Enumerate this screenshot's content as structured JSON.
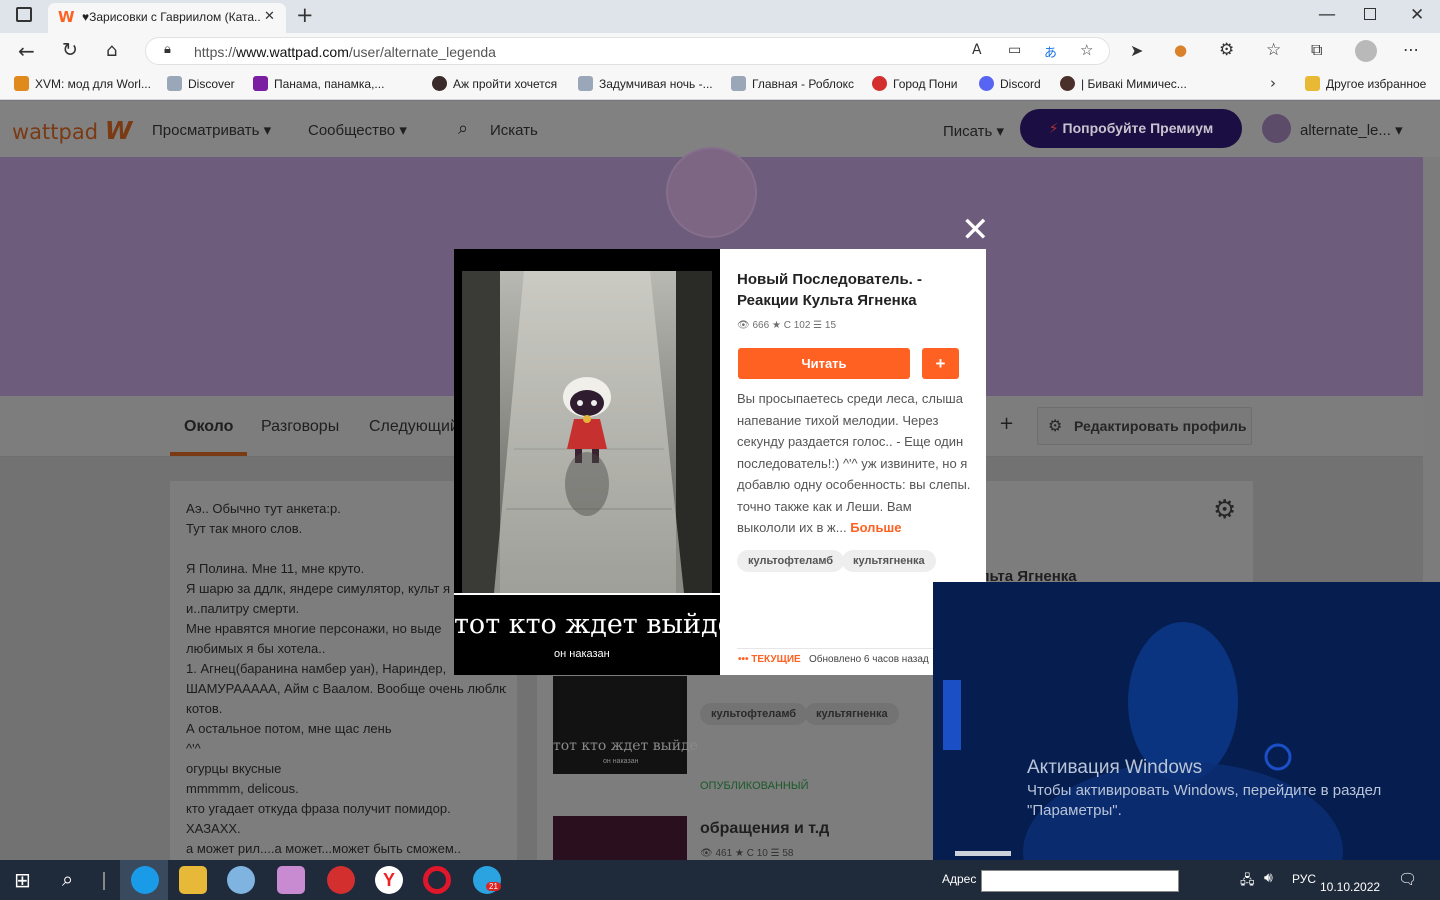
{
  "browser": {
    "tab_title": "♥Зарисовки с Гавриилом (Ката...",
    "url_prefix": "https://",
    "url_domain": "www.wattpad.com",
    "url_path": "/user/alternate_legenda",
    "favorites": [
      {
        "label": "XVM: мод для Worl...",
        "color": "#e08a1e"
      },
      {
        "label": "Discover",
        "color": "#9aa7b8"
      },
      {
        "label": "Панама, панамка,...",
        "color": "#7b1fa2"
      },
      {
        "label": "Аж пройти хочется",
        "color": "#3b2a2a"
      },
      {
        "label": "Задумчивая ночь -...",
        "color": "#9aa7b8"
      },
      {
        "label": "Главная - Роблокс",
        "color": "#9aa7b8"
      },
      {
        "label": "Город Пони",
        "color": "#d32f2f"
      },
      {
        "label": "Discord",
        "color": "#5865f2"
      },
      {
        "label": "| Бивакі Мимичес...",
        "color": "#4a2f2a"
      }
    ],
    "other_favorites": "Другое избранное"
  },
  "wattpad": {
    "logo": "wattpad",
    "browse": "Просматривать",
    "community": "Сообщество",
    "search": "Искать",
    "write": "Писать",
    "premium": "Попробуйте Премиум",
    "username": "alternate_le..."
  },
  "profile": {
    "tabs": [
      "Около",
      "Разговоры",
      "Следующий"
    ],
    "edit_profile": "Редактировать профиль",
    "about_lines": [
      "Аэ.. Обычно тут анкета:р.",
      "Тут так много слов.",
      "",
      "Я Полина. Мне 11, мне круто.",
      "Я шарю за ддлк, яндере симулятор, культ я",
      "и..палитру смерти.",
      "Мне нравятся многие персонажи, но выде",
      "любимых я бы хотела..",
      "1. Агнец(баранина намбер уан), Нариндер,",
      "ШАМУРААААА, Айм с Ваалом. Вообще очень люблю",
      "котов.",
      "А остальное потом, мне щас лень",
      "^'^",
      "огурцы вкусные",
      "mmmmm, delicous.",
      "кто угадает откуда фраза получит помидор.",
      "ХАЗАХХ.",
      "а может рил....а может...может быть сможем.."
    ],
    "stories": {
      "behind_title_fragment": "льта Ягненка",
      "tags": [
        "культофтеламб",
        "культягненка"
      ],
      "published_label": "ОПУБЛИКОВАННЫЙ",
      "second_title": "обращения и т.д",
      "second_stats": "461 ★ С 10 ☰ 58",
      "cover_caption": "тот кто ждет выйде",
      "cover_sub": "он наказан"
    }
  },
  "modal": {
    "title": "Новый Последователь. - Реакции Культа Ягненка",
    "stats": "666 ★ С 102 ☰ 15",
    "read": "Читать",
    "add": "+",
    "description": "Вы просыпаетесь среди леса, слыша напевание тихой мелодии. Через секунду раздается голос.. - Еще один последователь!:) ^'^ уж извините, но я добавлю одну особенность: вы слепы. точно также как и Леши. Вам выкололи их в ж...",
    "more": "Больше",
    "tags": [
      "культофтеламб",
      "культягненка"
    ],
    "ongoing": "ТЕКУЩИЕ",
    "updated": "Обновлено 6 часов назад",
    "cover_caption": "тот кто ждет выйде",
    "cover_sub": "он наказан"
  },
  "windows": {
    "activation_title": "Активация Windows",
    "activation_text": "Чтобы активировать Windows, перейдите в раздел \"Параметры\".",
    "address_label": "Адрес",
    "lang": "РУС",
    "date": "10.10.2022",
    "telegram_badge": "21"
  }
}
